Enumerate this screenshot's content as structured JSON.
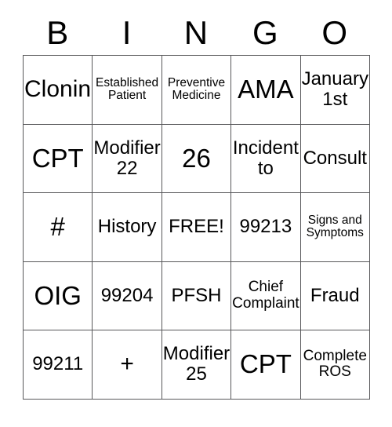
{
  "card": {
    "headers": [
      "B",
      "I",
      "N",
      "G",
      "O"
    ],
    "rows": [
      [
        {
          "text": "Cloning",
          "size": "lg"
        },
        {
          "text": "Established\nPatient",
          "size": "xs"
        },
        {
          "text": "Preventive\nMedicine",
          "size": "xs"
        },
        {
          "text": "AMA",
          "size": "xl"
        },
        {
          "text": "January\n1st",
          "size": "md"
        }
      ],
      [
        {
          "text": "CPT",
          "size": "xl"
        },
        {
          "text": "Modifier\n22",
          "size": "md"
        },
        {
          "text": "26",
          "size": "xl"
        },
        {
          "text": "Incident\nto",
          "size": "md"
        },
        {
          "text": "Consult",
          "size": "md"
        }
      ],
      [
        {
          "text": "#",
          "size": "xl"
        },
        {
          "text": "History",
          "size": "md"
        },
        {
          "text": "FREE!",
          "size": "md"
        },
        {
          "text": "99213",
          "size": "md"
        },
        {
          "text": "Signs and\nSymptoms",
          "size": "xs"
        }
      ],
      [
        {
          "text": "OIG",
          "size": "xl"
        },
        {
          "text": "99204",
          "size": "md"
        },
        {
          "text": "PFSH",
          "size": "md"
        },
        {
          "text": "Chief\nComplaint",
          "size": "sm"
        },
        {
          "text": "Fraud",
          "size": "md"
        }
      ],
      [
        {
          "text": "99211",
          "size": "md"
        },
        {
          "text": "+",
          "size": "lg"
        },
        {
          "text": "Modifier\n25",
          "size": "md"
        },
        {
          "text": "CPT",
          "size": "xl"
        },
        {
          "text": "Complete\nROS",
          "size": "sm"
        }
      ]
    ]
  }
}
